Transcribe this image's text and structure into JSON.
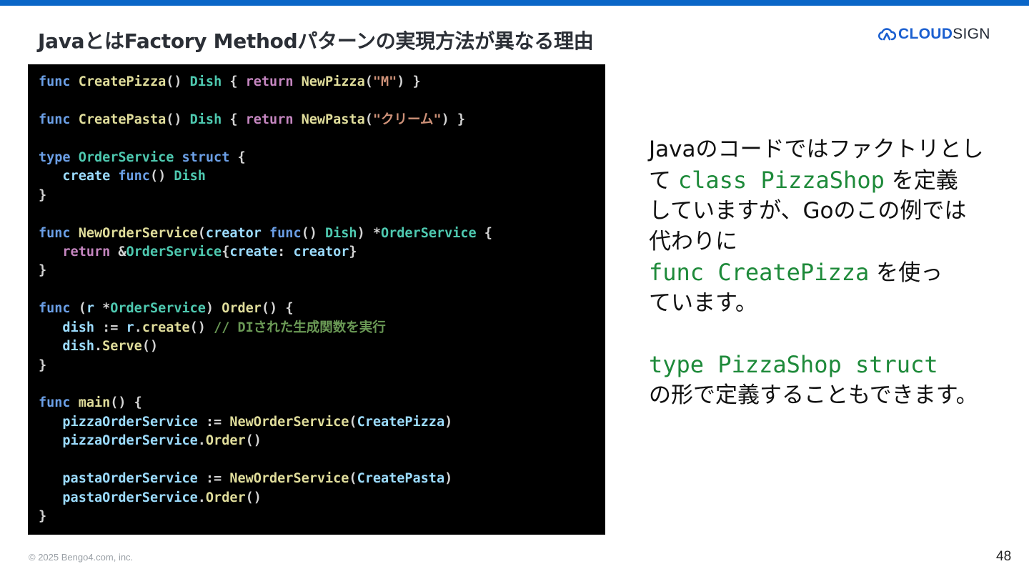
{
  "slide": {
    "title": "JavaとはFactory Methodパターンの実現方法が異なる理由",
    "page_number": "48",
    "copyright": "© 2025 Bengo4.com, inc."
  },
  "logo": {
    "icon": "cloudsign-logo-icon",
    "text_cloud": "CLOUD",
    "text_sign": "SIGN",
    "colors": {
      "cloud": "#1a5fd0",
      "sign": "#232a36"
    }
  },
  "accent_color": "#0a66c7",
  "code": {
    "lines": [
      [
        [
          "kw-blue",
          "func"
        ],
        [
          "punct",
          " "
        ],
        [
          "fn-yellow",
          "CreatePizza"
        ],
        [
          "punct",
          "() "
        ],
        [
          "type-green",
          "Dish"
        ],
        [
          "punct",
          " { "
        ],
        [
          "kw-purple",
          "return"
        ],
        [
          "punct",
          " "
        ],
        [
          "fn-yellow",
          "NewPizza"
        ],
        [
          "punct",
          "("
        ],
        [
          "str",
          "\"M\""
        ],
        [
          "punct",
          ") }"
        ]
      ],
      [],
      [
        [
          "kw-blue",
          "func"
        ],
        [
          "punct",
          " "
        ],
        [
          "fn-yellow",
          "CreatePasta"
        ],
        [
          "punct",
          "() "
        ],
        [
          "type-green",
          "Dish"
        ],
        [
          "punct",
          " { "
        ],
        [
          "kw-purple",
          "return"
        ],
        [
          "punct",
          " "
        ],
        [
          "fn-yellow",
          "NewPasta"
        ],
        [
          "punct",
          "("
        ],
        [
          "str",
          "\"クリーム\""
        ],
        [
          "punct",
          ") }"
        ]
      ],
      [],
      [
        [
          "kw-blue",
          "type"
        ],
        [
          "punct",
          " "
        ],
        [
          "type-green",
          "OrderService"
        ],
        [
          "punct",
          " "
        ],
        [
          "kw-blue",
          "struct"
        ],
        [
          "punct",
          " {"
        ]
      ],
      [
        [
          "punct",
          "   "
        ],
        [
          "var-blue",
          "create"
        ],
        [
          "punct",
          " "
        ],
        [
          "kw-blue",
          "func"
        ],
        [
          "punct",
          "() "
        ],
        [
          "type-green",
          "Dish"
        ]
      ],
      [
        [
          "punct",
          "}"
        ]
      ],
      [],
      [
        [
          "kw-blue",
          "func"
        ],
        [
          "punct",
          " "
        ],
        [
          "fn-yellow",
          "NewOrderService"
        ],
        [
          "punct",
          "("
        ],
        [
          "var-blue",
          "creator"
        ],
        [
          "punct",
          " "
        ],
        [
          "kw-blue",
          "func"
        ],
        [
          "punct",
          "() "
        ],
        [
          "type-green",
          "Dish"
        ],
        [
          "punct",
          ") *"
        ],
        [
          "type-green",
          "OrderService"
        ],
        [
          "punct",
          " {"
        ]
      ],
      [
        [
          "punct",
          "   "
        ],
        [
          "kw-purple",
          "return"
        ],
        [
          "punct",
          " &"
        ],
        [
          "type-green",
          "OrderService"
        ],
        [
          "punct",
          "{"
        ],
        [
          "var-blue",
          "create"
        ],
        [
          "punct",
          ": "
        ],
        [
          "var-blue",
          "creator"
        ],
        [
          "punct",
          "}"
        ]
      ],
      [
        [
          "punct",
          "}"
        ]
      ],
      [],
      [
        [
          "kw-blue",
          "func"
        ],
        [
          "punct",
          " ("
        ],
        [
          "var-blue",
          "r"
        ],
        [
          "punct",
          " *"
        ],
        [
          "type-green",
          "OrderService"
        ],
        [
          "punct",
          ") "
        ],
        [
          "fn-yellow",
          "Order"
        ],
        [
          "punct",
          "() {"
        ]
      ],
      [
        [
          "punct",
          "   "
        ],
        [
          "var-blue",
          "dish"
        ],
        [
          "punct",
          " := "
        ],
        [
          "var-blue",
          "r"
        ],
        [
          "punct",
          "."
        ],
        [
          "fn-yellow",
          "create"
        ],
        [
          "punct",
          "() "
        ],
        [
          "cmt",
          "// DIされた生成関数を実行"
        ]
      ],
      [
        [
          "punct",
          "   "
        ],
        [
          "var-blue",
          "dish"
        ],
        [
          "punct",
          "."
        ],
        [
          "fn-yellow",
          "Serve"
        ],
        [
          "punct",
          "()"
        ]
      ],
      [
        [
          "punct",
          "}"
        ]
      ],
      [],
      [
        [
          "kw-blue",
          "func"
        ],
        [
          "punct",
          " "
        ],
        [
          "fn-yellow",
          "main"
        ],
        [
          "punct",
          "() {"
        ]
      ],
      [
        [
          "punct",
          "   "
        ],
        [
          "var-blue",
          "pizzaOrderService"
        ],
        [
          "punct",
          " := "
        ],
        [
          "fn-yellow",
          "NewOrderService"
        ],
        [
          "punct",
          "("
        ],
        [
          "var-blue",
          "CreatePizza"
        ],
        [
          "punct",
          ")"
        ]
      ],
      [
        [
          "punct",
          "   "
        ],
        [
          "var-blue",
          "pizzaOrderService"
        ],
        [
          "punct",
          "."
        ],
        [
          "fn-yellow",
          "Order"
        ],
        [
          "punct",
          "()"
        ]
      ],
      [],
      [
        [
          "punct",
          "   "
        ],
        [
          "var-blue",
          "pastaOrderService"
        ],
        [
          "punct",
          " := "
        ],
        [
          "fn-yellow",
          "NewOrderService"
        ],
        [
          "punct",
          "("
        ],
        [
          "var-blue",
          "CreatePasta"
        ],
        [
          "punct",
          ")"
        ]
      ],
      [
        [
          "punct",
          "   "
        ],
        [
          "var-blue",
          "pastaOrderService"
        ],
        [
          "punct",
          "."
        ],
        [
          "fn-yellow",
          "Order"
        ],
        [
          "punct",
          "()"
        ]
      ],
      [
        [
          "punct",
          "}"
        ]
      ]
    ]
  },
  "explanation": {
    "line1": "Javaのコードではファクトリとし",
    "line2_pre": "て ",
    "line2_code": "class PizzaShop",
    "line2_post": " を定義",
    "line3": "していますが、Goのこの例では",
    "line4": "代わりに",
    "line5_code": " func CreatePizza",
    "line5_post": " を使っ",
    "line6": "ています。",
    "line7_code": "type PizzaShop struct",
    "line8": "の形で定義することもできます。"
  }
}
